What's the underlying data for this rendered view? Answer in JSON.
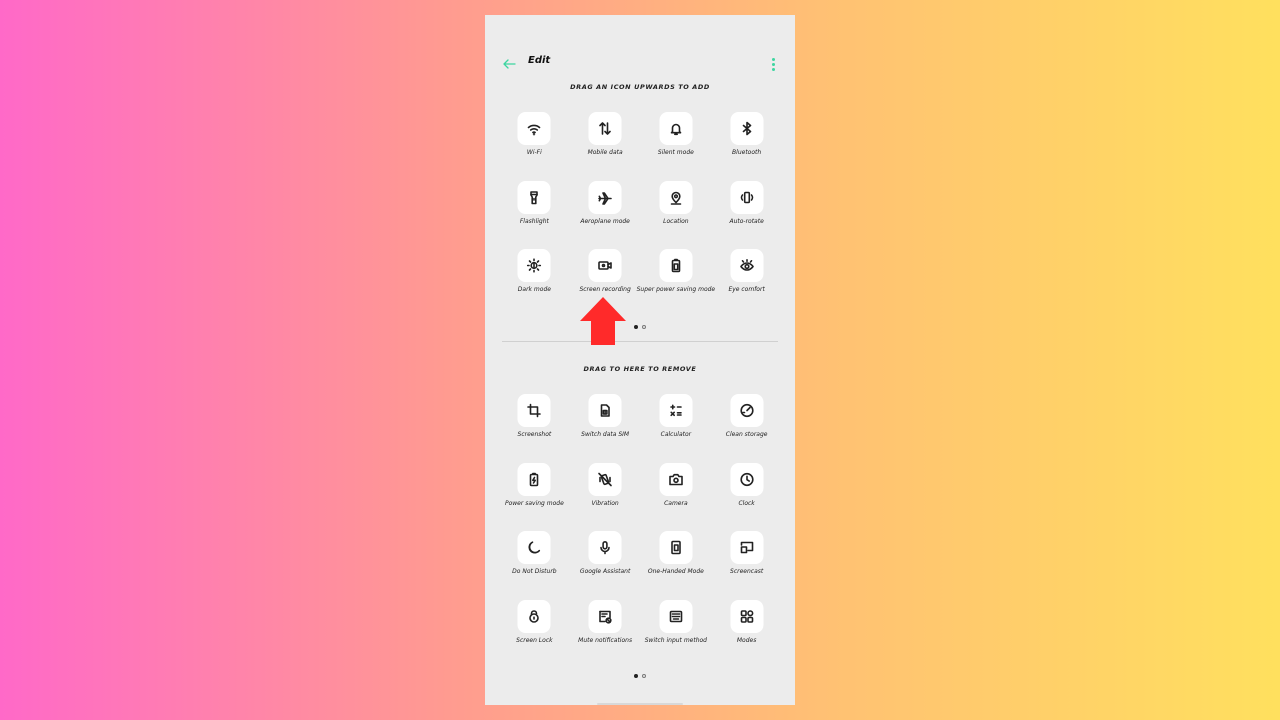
{
  "header": {
    "title": "Edit",
    "back_icon": "back-arrow-icon",
    "menu_icon": "more-vertical-icon"
  },
  "add_section": {
    "title": "DRAG AN ICON UPWARDS TO ADD",
    "tiles": [
      {
        "label": "Wi-Fi",
        "icon": "wifi"
      },
      {
        "label": "Mobile data",
        "icon": "mobile-data"
      },
      {
        "label": "Silent mode",
        "icon": "bell"
      },
      {
        "label": "Bluetooth",
        "icon": "bluetooth"
      },
      {
        "label": "Flashlight",
        "icon": "flashlight"
      },
      {
        "label": "Aeroplane mode",
        "icon": "airplane"
      },
      {
        "label": "Location",
        "icon": "location"
      },
      {
        "label": "Auto-rotate",
        "icon": "auto-rotate"
      },
      {
        "label": "Dark mode",
        "icon": "dark-mode"
      },
      {
        "label": "Screen recording",
        "icon": "screen-record"
      },
      {
        "label": "Super power saving mode",
        "icon": "battery-saver"
      },
      {
        "label": "Eye comfort",
        "icon": "eye"
      }
    ],
    "page_indicator": {
      "current": 1,
      "total": 2
    }
  },
  "remove_section": {
    "title": "DRAG TO HERE TO REMOVE",
    "tiles": [
      {
        "label": "Screenshot",
        "icon": "crop"
      },
      {
        "label": "Switch data SIM",
        "icon": "sim"
      },
      {
        "label": "Calculator",
        "icon": "calculator"
      },
      {
        "label": "Clean storage",
        "icon": "gauge"
      },
      {
        "label": "Power saving mode",
        "icon": "battery-bolt"
      },
      {
        "label": "Vibration",
        "icon": "vibration"
      },
      {
        "label": "Camera",
        "icon": "camera"
      },
      {
        "label": "Clock",
        "icon": "clock"
      },
      {
        "label": "Do Not Disturb",
        "icon": "moon"
      },
      {
        "label": "Google Assistant",
        "icon": "mic"
      },
      {
        "label": "One-Handed Mode",
        "icon": "one-hand"
      },
      {
        "label": "Screencast",
        "icon": "screencast"
      },
      {
        "label": "Screen Lock",
        "icon": "lock"
      },
      {
        "label": "Mute notifications",
        "icon": "mute-notif"
      },
      {
        "label": "Switch input method",
        "icon": "keyboard"
      },
      {
        "label": "Modes",
        "icon": "modes"
      }
    ],
    "page_indicator": {
      "current": 1,
      "total": 2
    }
  },
  "annotation": {
    "arrow_color": "#ff2a2a",
    "accent_color": "#3dd5a0"
  }
}
